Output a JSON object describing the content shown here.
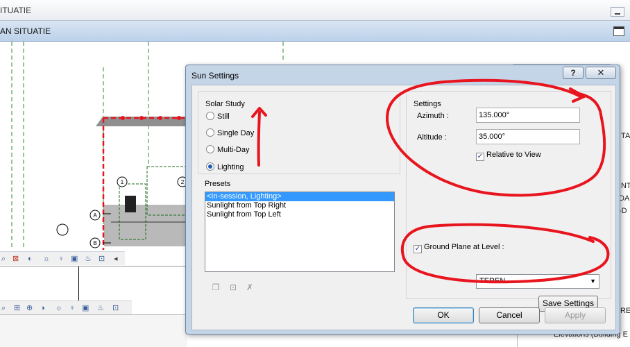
{
  "background": {
    "window_title_fragment": "ITUATIE",
    "view_tab_fragment": "AN SITUATIE",
    "grid_labels": [
      "A",
      "B",
      "1",
      "2"
    ],
    "right_edge_texts": [
      "ITA",
      "INT",
      "DAF",
      "-D",
      "RE"
    ],
    "project_browser_item": "Elevations (Building E"
  },
  "dialog": {
    "title": "Sun Settings",
    "help_label": "?",
    "close_label": "✕",
    "solar_study": {
      "group_label": "Solar Study",
      "options": [
        {
          "label": "Still",
          "selected": false
        },
        {
          "label": "Single Day",
          "selected": false
        },
        {
          "label": "Multi-Day",
          "selected": false
        },
        {
          "label": "Lighting",
          "selected": true
        }
      ]
    },
    "presets": {
      "group_label": "Presets",
      "items": [
        {
          "label": "<In-session, Lighting>",
          "selected": true
        },
        {
          "label": "Sunlight from Top Right",
          "selected": false
        },
        {
          "label": "Sunlight from Top Left",
          "selected": false
        }
      ],
      "icons": [
        "duplicate-preset-icon",
        "rename-preset-icon",
        "delete-preset-icon"
      ]
    },
    "settings": {
      "group_label": "Settings",
      "azimuth_label": "Azimuth :",
      "azimuth_value": "135.000°",
      "altitude_label": "Altitude :",
      "altitude_value": "35.000°",
      "relative_to_view_label": "Relative to View",
      "relative_to_view_checked": true,
      "ground_plane_label": "Ground Plane at Level :",
      "ground_plane_checked": true,
      "ground_plane_level": "TEREN",
      "save_settings_label": "Save Settings"
    },
    "buttons": {
      "ok": "OK",
      "cancel": "Cancel",
      "apply": "Apply"
    }
  },
  "colors": {
    "annotation_red": "#e8141e",
    "dialog_frame": "#c5d5e8",
    "selection_blue": "#3399ff",
    "grid_green": "#2e8b2e"
  }
}
